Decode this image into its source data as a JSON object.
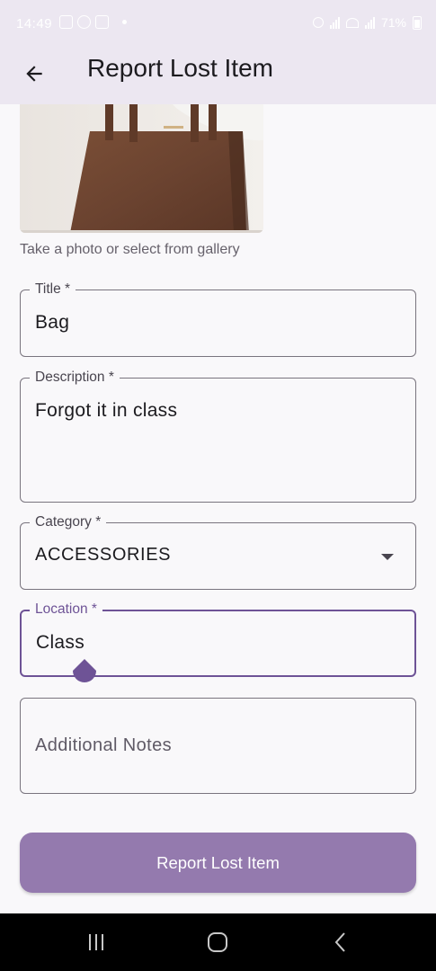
{
  "status_bar": {
    "time": "14:49",
    "battery": "71%"
  },
  "app_bar": {
    "title": "Report Lost Item",
    "back_icon": "arrow-back-icon"
  },
  "photo": {
    "hint": "Take a photo or select from gallery",
    "subject": "brown leather tote bag"
  },
  "form": {
    "title": {
      "label": "Title *",
      "value": "Bag"
    },
    "description": {
      "label": "Description *",
      "value": "Forgot it in class"
    },
    "category": {
      "label": "Category *",
      "value": "ACCESSORIES",
      "icon": "dropdown-arrow-icon"
    },
    "location": {
      "label": "Location *",
      "value": "Class"
    },
    "notes": {
      "placeholder": "Additional Notes",
      "value": ""
    }
  },
  "submit_label": "Report Lost Item",
  "colors": {
    "primary": "#6e5396",
    "button": "#947aae",
    "app_bar": "#ece7f1",
    "background": "#f9f8fa"
  },
  "nav_bar": {
    "icons": [
      "recent-apps-icon",
      "home-icon",
      "back-icon"
    ]
  }
}
